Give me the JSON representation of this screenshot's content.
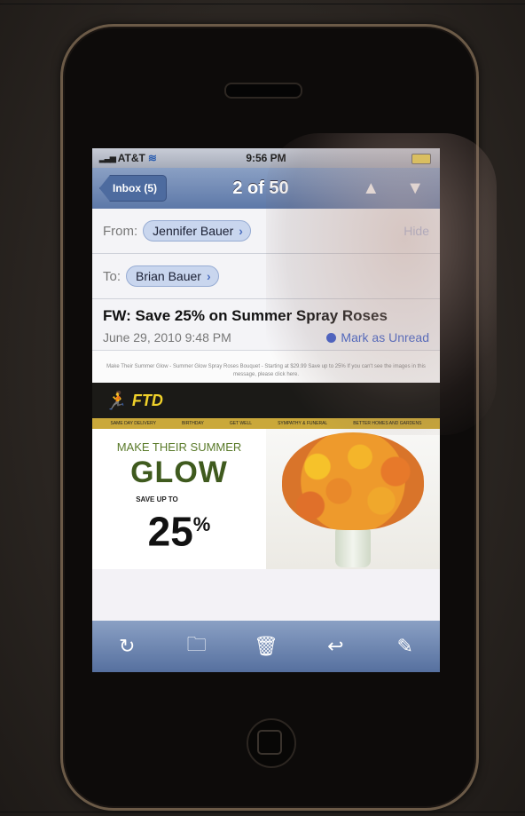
{
  "status_bar": {
    "carrier": "AT&T",
    "time": "9:56 PM"
  },
  "nav": {
    "back_label": "Inbox (5)",
    "title": "2 of 50",
    "up_icon": "arrow-up-icon",
    "down_icon": "arrow-down-icon"
  },
  "message": {
    "from_label": "From:",
    "from_name": "Jennifer Bauer",
    "hide_label": "Hide",
    "to_label": "To:",
    "to_name": "Brian Bauer",
    "subject": "FW: Save 25% on Summer Spray Roses",
    "date": "June 29, 2010 9:48 PM",
    "mark_unread": "Mark as Unread"
  },
  "email_body": {
    "preheader": "Make Their Summer Glow - Summer Glow Spray Roses Bouquet - Starting at $29.99 Save up to 25% If you can't see the images in this message, please click here.",
    "logo_text": "FTD",
    "nav_items": [
      "SAME DAY DELIVERY",
      "BIRTHDAY",
      "GET WELL",
      "SYMPATHY & FUNERAL",
      "BETTER HOMES AND GARDENS"
    ],
    "headline": "MAKE THEIR SUMMER",
    "glow": "GLOW",
    "save_up": "SAVE UP TO",
    "percent": "25",
    "percent_sign": "%"
  },
  "toolbar": [
    "refresh-icon",
    "move-folder-icon",
    "trash-icon",
    "reply-icon",
    "compose-icon"
  ]
}
